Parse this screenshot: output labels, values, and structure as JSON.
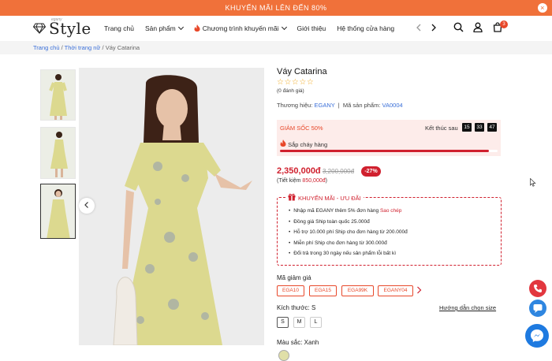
{
  "promo_bar": {
    "text": "KHUYẾN MÃI LÊN ĐẾN 80%",
    "close_icon": "×"
  },
  "header": {
    "logo_sub": "egany",
    "logo_text": "Style",
    "nav": [
      {
        "label": "Trang chủ",
        "has_chevron": false
      },
      {
        "label": "Sản phẩm",
        "has_chevron": true
      },
      {
        "label": "Chương trình khuyến mãi",
        "has_chevron": true,
        "icon": "flame-icon"
      },
      {
        "label": "Giới thiệu",
        "has_chevron": false
      },
      {
        "label": "Hệ thống cửa hàng",
        "has_chevron": false
      }
    ],
    "cart_count": "3"
  },
  "breadcrumb": {
    "home": "Trang chủ",
    "category": "Thời trang nữ",
    "current": "Váy Catarina",
    "separator": "/"
  },
  "product": {
    "title": "Váy Catarina",
    "stars": "☆☆☆☆☆",
    "reviews": "(0 đánh giá)",
    "brand_label": "Thương hiệu:",
    "brand": "EGANY",
    "sku_label": "Mã sản phẩm:",
    "sku": "VA0004",
    "flash_sale": {
      "label": "GIẢM SỐC 50%",
      "ends_label": "Kết thúc sau",
      "countdown": [
        "15",
        "33",
        "47"
      ],
      "selling_label": "Sắp cháy hàng",
      "progress": 0.96
    },
    "price": "2,350,000đ",
    "old_price": "3,200,000đ",
    "discount": "-27%",
    "saving_prefix": "(Tiết kiệm ",
    "saving_amount": "850,000đ",
    "saving_suffix": ")",
    "promo": {
      "title": "KHUYẾN MÃI - ƯU ĐÃI",
      "items": [
        {
          "text": "Nhập mã EGANY thêm 5% đơn hàng ",
          "link": "Sao chép"
        },
        {
          "text": "Đồng giá Ship toàn quốc 25.000đ"
        },
        {
          "text": "Hỗ trợ 10.000 phí Ship cho đơn hàng từ 200.000đ"
        },
        {
          "text": "Miễn phí Ship cho đơn hàng từ 300.000đ"
        },
        {
          "text": "Đổi trả trong 30 ngày nếu sản phẩm lỗi bất kì"
        }
      ]
    },
    "coupon_label": "Mã giảm giá",
    "coupons": [
      "EGA10",
      "EGA15",
      "EGA99K",
      "EGANY04"
    ],
    "size_label": "Kích thước: S",
    "size_guide": "Hướng dẫn chọn size",
    "sizes": [
      "S",
      "M",
      "L"
    ],
    "selected_size": "S",
    "color_label": "Màu sắc: Xanh",
    "swatch_color": "#e0dfa8"
  },
  "colors": {
    "accent": "#f0713a",
    "price_red": "#d0202e",
    "link_blue": "#3a6fd8",
    "phone_red": "#e2373f",
    "zalo_blue": "#2f86e0",
    "messenger_blue": "#1e7ae0"
  }
}
